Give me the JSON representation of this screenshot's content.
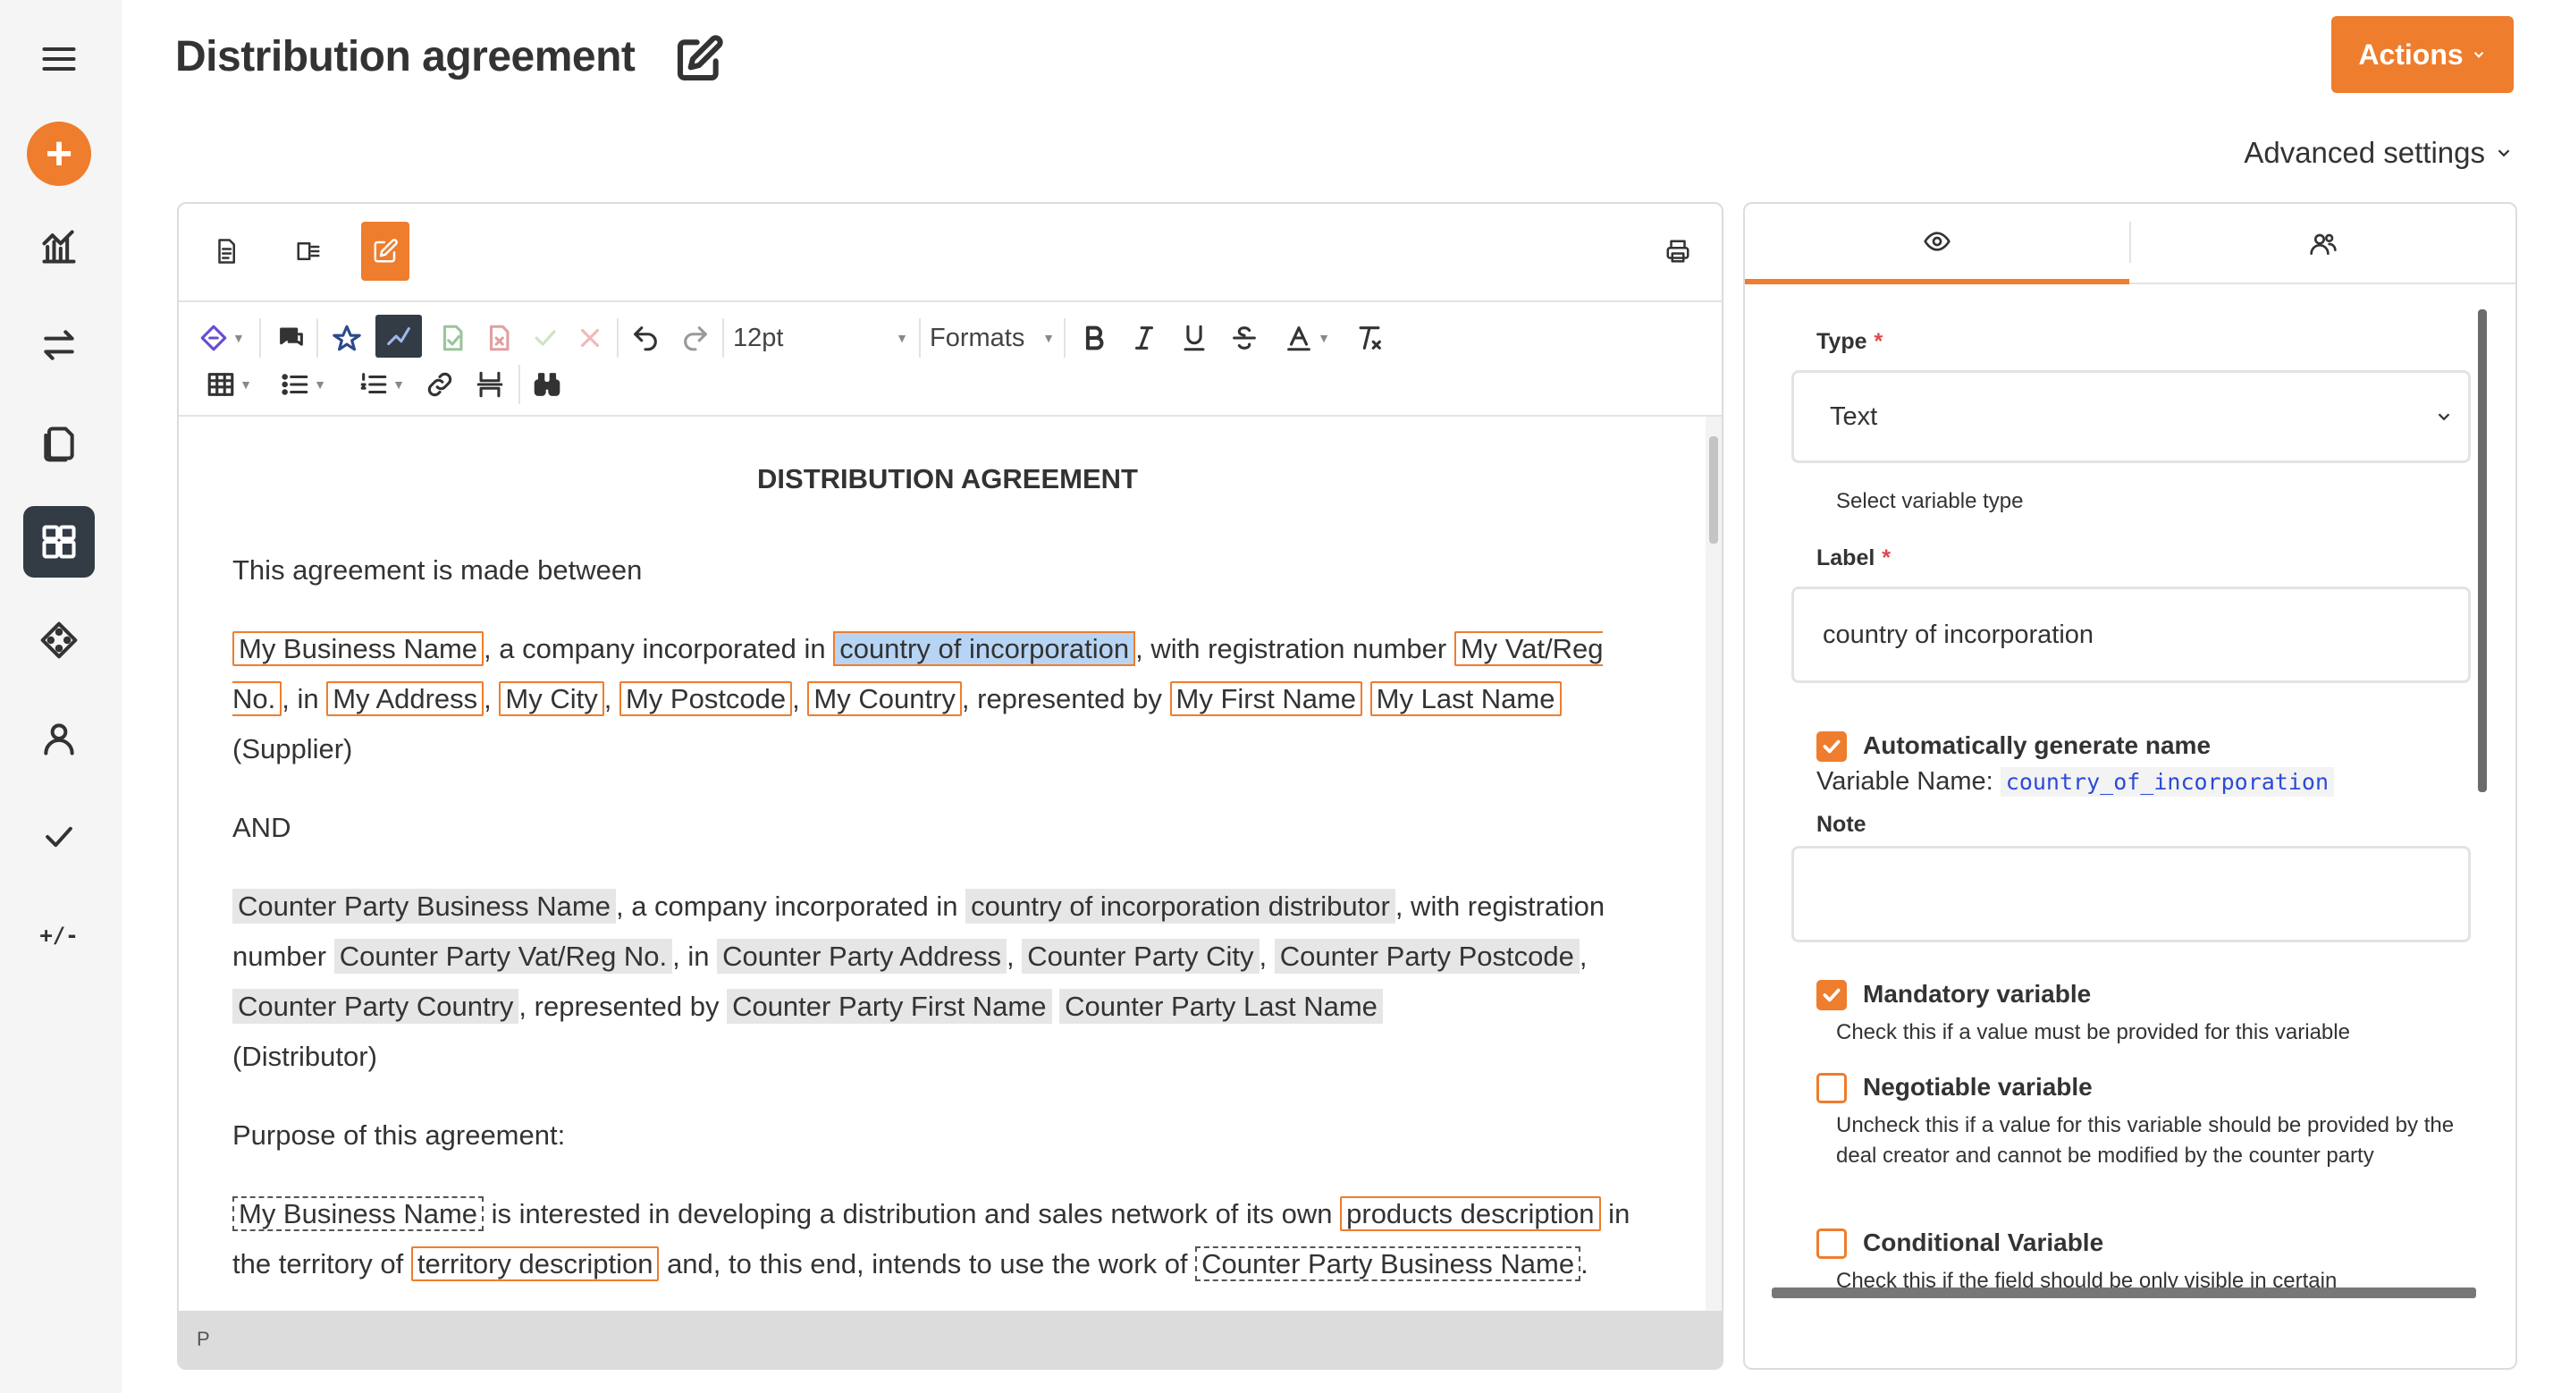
{
  "sidebar": {
    "items": [
      {
        "icon": "menu-icon"
      },
      {
        "icon": "plus-icon",
        "label": "+"
      },
      {
        "icon": "analytics-icon"
      },
      {
        "icon": "transfer-icon"
      },
      {
        "icon": "documents-icon"
      },
      {
        "icon": "templates-icon"
      },
      {
        "icon": "variables-icon"
      },
      {
        "icon": "user-icon"
      },
      {
        "icon": "check-icon"
      },
      {
        "icon": "plus-minus-icon",
        "label": "+/-"
      }
    ]
  },
  "header": {
    "title": "Distribution agreement",
    "actions_label": "Actions",
    "advanced_settings_label": "Advanced settings"
  },
  "editor": {
    "toolbar": {
      "font_size": "12pt",
      "formats_label": "Formats"
    },
    "status_path": "P",
    "document": {
      "heading": "DISTRIBUTION AGREEMENT",
      "intro": "This agreement is made between",
      "and": "AND",
      "supplier": {
        "business_name": "My Business Name",
        "t_incorporated": ", a company incorporated in ",
        "country": "country of incorporation",
        "t_regnum": ", with registration number ",
        "vat": "My Vat/Reg No.",
        "t_in": ", in ",
        "address": "My Address",
        "comma1": ", ",
        "city": "My City",
        "comma2": ", ",
        "postcode": "My Postcode",
        "comma3": ", ",
        "country_name": "My Country",
        "t_represented": ", represented by ",
        "first_name": "My First Name",
        "last_name": "My Last Name",
        "role": " (Supplier)"
      },
      "distributor": {
        "business_name": "Counter Party Business Name",
        "t_incorporated": ", a company incorporated in ",
        "country": "country of incorporation distributor",
        "t_regnum": ", with registration number ",
        "vat": "Counter Party Vat/Reg No.",
        "t_in": ", in ",
        "address": "Counter Party Address",
        "comma1": ", ",
        "city": "Counter Party City",
        "comma2": ", ",
        "postcode": "Counter Party Postcode",
        "comma3": ", ",
        "country_name": "Counter Party Country",
        "t_represented": ", represented by ",
        "first_name": "Counter Party First Name",
        "last_name": "Counter Party Last Name",
        "role": "(Distributor)"
      },
      "purpose_heading": "Purpose of this agreement:",
      "purpose": {
        "business_name": "My Business Name",
        "t_interested": " is interested in developing a distribution and sales network of its own ",
        "products": "products description",
        "t_territory": " in the territory of ",
        "territory": "territory description",
        "t_intends": " and, to this end, intends to use the work of ",
        "cp_business": "Counter Party Business Name",
        "t_end": "."
      }
    }
  },
  "properties": {
    "type_label": "Type",
    "type_value": "Text",
    "type_help": "Select variable type",
    "label_label": "Label",
    "label_value": "country of incorporation",
    "auto_name_label": "Automatically generate name",
    "auto_name_checked": true,
    "variable_name_prefix": "Variable Name:",
    "variable_name": "country_of_incorporation",
    "note_label": "Note",
    "note_value": "",
    "mandatory_label": "Mandatory variable",
    "mandatory_checked": true,
    "mandatory_help": "Check this if a value must be provided for this variable",
    "negotiable_label": "Negotiable variable",
    "negotiable_checked": false,
    "negotiable_help": "Uncheck this if a value for this variable should be provided by the deal creator and cannot be modified by the counter party",
    "conditional_label": "Conditional Variable",
    "conditional_checked": false,
    "conditional_help": "Check this if the field should be only visible in certain"
  },
  "colors": {
    "accent": "#ee7d2d",
    "sidebar_active": "#333b45",
    "selection": "#b7d4f5",
    "required": "#e0464a",
    "variable_name_text": "#2b4bd6"
  }
}
